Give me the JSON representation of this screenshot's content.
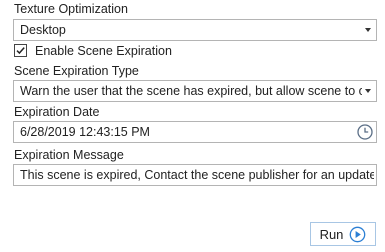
{
  "texture": {
    "label": "Texture Optimization",
    "value": "Desktop"
  },
  "expiration_checkbox": {
    "label": "Enable Scene Expiration",
    "checked": true
  },
  "expiration_type": {
    "label": "Scene Expiration Type",
    "value": "Warn the user that the scene has expired, but allow scene to open"
  },
  "expiration_date": {
    "label": "Expiration Date",
    "value": "6/28/2019 12:43:15 PM"
  },
  "expiration_message": {
    "label": "Expiration Message",
    "value": "This scene is expired, Contact the scene publisher for an updated scene"
  },
  "run_button": {
    "label": "Run"
  },
  "icons": {
    "run": "play-circle-icon",
    "date": "clock-icon",
    "dropdown": "chevron-down-icon",
    "checkbox": "checkmark-icon"
  },
  "colors": {
    "accent": "#2b7fd4",
    "border": "#b4b4b4",
    "button_border": "#a8c6e4"
  }
}
